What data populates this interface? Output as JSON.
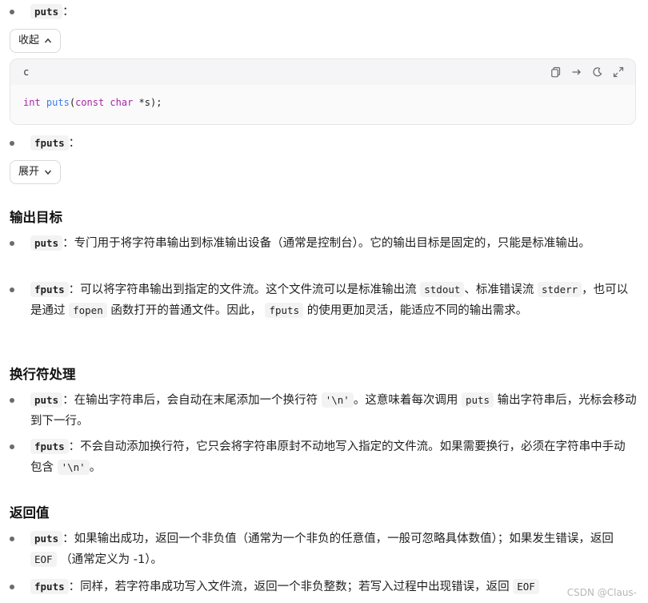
{
  "puts_label": "puts",
  "fputs_label": "fputs",
  "colon": "：",
  "collapse_label": "收起",
  "expand_label": "展开",
  "code": {
    "lang": "c",
    "kw_int": "int",
    "fn": "puts",
    "open": "(",
    "kw_const": "const",
    "kw_char": "char",
    "rest": " *s);"
  },
  "sections": {
    "output_target": {
      "title": "输出目标",
      "puts_text": "：专门用于将字符串输出到标准输出设备（通常是控制台）。它的输出目标是固定的，只能是标准输出。",
      "fputs_a": "：可以将字符串输出到指定的文件流。这个文件流可以是标准输出流",
      "stdout": "stdout",
      "fputs_b": "、标准错误流",
      "stderr": "stderr",
      "fputs_c": "，也可以是通过",
      "fopen": "fopen",
      "fputs_d": "函数打开的普通文件。因此，",
      "fputs_code": "fputs",
      "fputs_e": "的使用更加灵活，能适应不同的输出需求。"
    },
    "newline": {
      "title": "换行符处理",
      "puts_a": "：在输出字符串后，会自动在末尾添加一个换行符",
      "nl": "'\\n'",
      "puts_b": "。这意味着每次调用",
      "puts_code": "puts",
      "puts_c": "输出字符串后，光标会移动到下一行。",
      "fputs_a": "：不会自动添加换行符，它只会将字符串原封不动地写入指定的文件流。如果需要换行，必须在字符串中手动包含",
      "nl2": "'\\n'",
      "fputs_b": "。"
    },
    "return_value": {
      "title": "返回值",
      "puts_a": "：如果输出成功，返回一个非负值（通常为一个非负的任意值，一般可忽略具体数值）；如果发生错误，返回",
      "eof": "EOF",
      "puts_b": "（通常定义为 -1）。",
      "fputs_a": "：同样，若字符串成功写入文件流，返回一个非负整数；若写入过程中出现错误，返回",
      "eof2": "EOF"
    }
  },
  "watermark": "CSDN @Claus-"
}
